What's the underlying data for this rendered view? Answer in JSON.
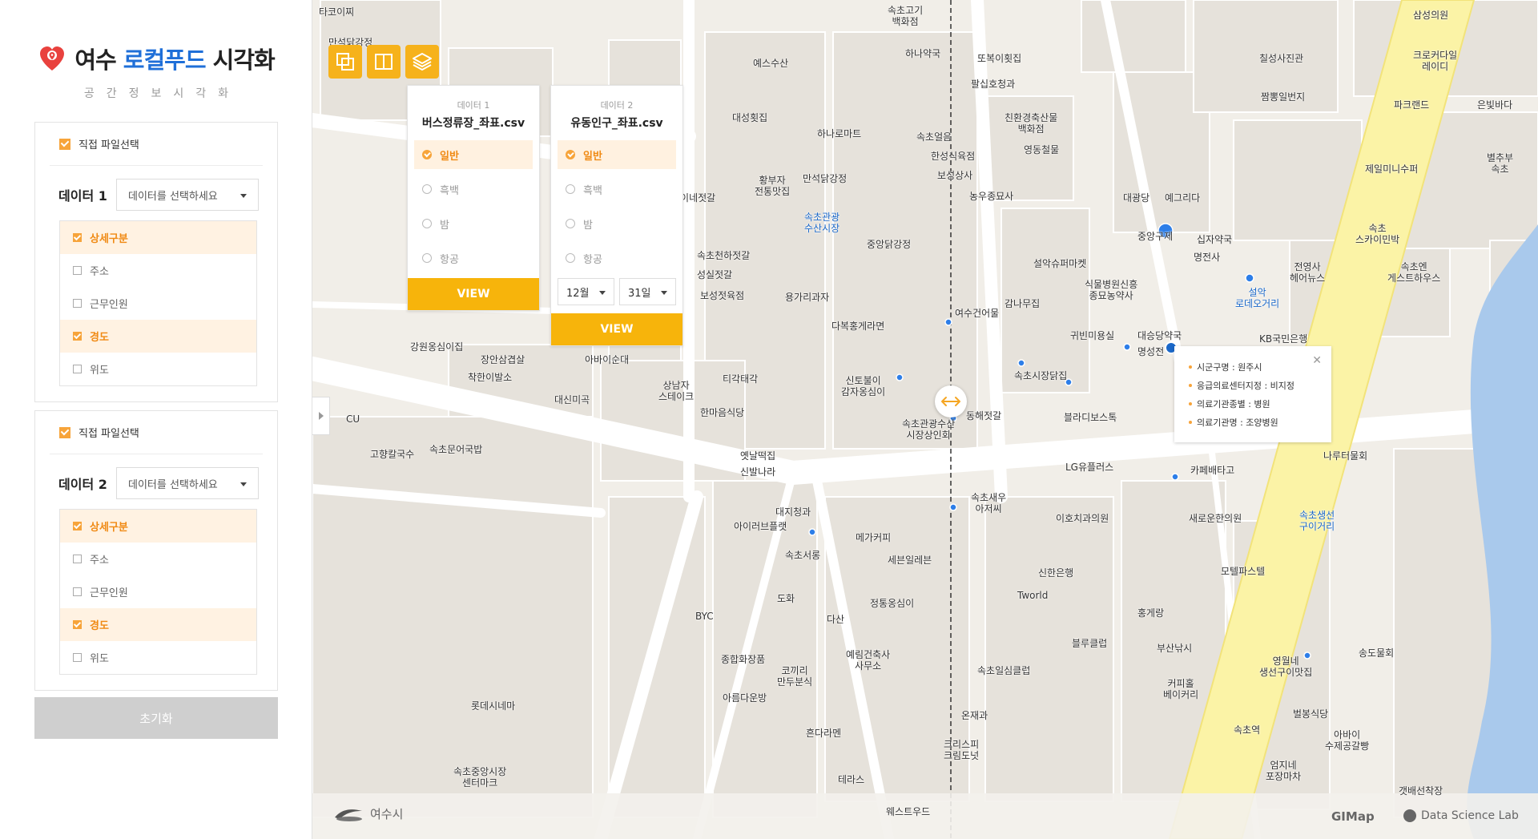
{
  "app": {
    "title_prefix": "여수",
    "title_accent": "로컬푸드",
    "title_suffix": "시각화",
    "subtitle": "공간정보시각화"
  },
  "panels": [
    {
      "file_select_label": "직접 파일선택",
      "data_label": "데이터 1",
      "select_placeholder": "데이터를 선택하세요",
      "fields": [
        {
          "label": "상세구분",
          "checked": true
        },
        {
          "label": "주소",
          "checked": false
        },
        {
          "label": "근무인원",
          "checked": false
        },
        {
          "label": "경도",
          "checked": true
        },
        {
          "label": "위도",
          "checked": false
        }
      ]
    },
    {
      "file_select_label": "직접 파일선택",
      "data_label": "데이터 2",
      "select_placeholder": "데이터를 선택하세요",
      "fields": [
        {
          "label": "상세구분",
          "checked": true
        },
        {
          "label": "주소",
          "checked": false
        },
        {
          "label": "근무인원",
          "checked": false
        },
        {
          "label": "경도",
          "checked": true
        },
        {
          "label": "위도",
          "checked": false
        }
      ]
    }
  ],
  "reset_label": "초기화",
  "cards": [
    {
      "num": "데이터 1",
      "file": "버스정류장_좌표.csv",
      "styles": [
        {
          "label": "일반",
          "on": true
        },
        {
          "label": "흑백",
          "on": false
        },
        {
          "label": "밤",
          "on": false
        },
        {
          "label": "항공",
          "on": false
        }
      ],
      "view_label": "VIEW"
    },
    {
      "num": "데이터 2",
      "file": "유동인구_좌표.csv",
      "styles": [
        {
          "label": "일반",
          "on": true
        },
        {
          "label": "흑백",
          "on": false
        },
        {
          "label": "밤",
          "on": false
        },
        {
          "label": "항공",
          "on": false
        }
      ],
      "month": "12월",
      "day": "31일",
      "view_label": "VIEW"
    }
  ],
  "info_popup": [
    "시군구명 : 원주시",
    "응급의료센터지정 : 비지정",
    "의료기관종별 : 병원",
    "의료기관명 : 조양병원"
  ],
  "map_labels": [
    {
      "t": "타코이찌"
    },
    {
      "t": "만석닭강정"
    },
    {
      "t": "속초고기\n백화점"
    },
    {
      "t": "하나약국"
    },
    {
      "t": "또복이횟집"
    },
    {
      "t": "팔십호청과"
    },
    {
      "t": "삼성의원"
    },
    {
      "t": "칠성사진관"
    },
    {
      "t": "크로커다일\n레이디"
    },
    {
      "t": "짬뽕일번지"
    },
    {
      "t": "파크랜드"
    },
    {
      "t": "은빛바다"
    },
    {
      "t": "예스수산"
    },
    {
      "t": "대성횟집"
    },
    {
      "t": "하나로마트"
    },
    {
      "t": "속초얼음"
    },
    {
      "t": "한성식육점"
    },
    {
      "t": "친환경축산물\n백화점"
    },
    {
      "t": "영동철물"
    },
    {
      "t": "보성상사"
    },
    {
      "t": "농우종묘사"
    },
    {
      "t": "대광당"
    },
    {
      "t": "예그리다"
    },
    {
      "t": "중앙구제"
    },
    {
      "t": "십자약국"
    },
    {
      "t": "명전사"
    },
    {
      "t": "제일미니수퍼"
    },
    {
      "t": "별추부\n속초"
    },
    {
      "t": "속초\n스카이민박"
    },
    {
      "t": "전영사\n헤어뉴스"
    },
    {
      "t": "속초엔\n게스트하우스"
    },
    {
      "t": "황부자\n전통맛집"
    },
    {
      "t": "만석닭강정"
    },
    {
      "t": "속초관광\n수산시장"
    },
    {
      "t": "중앙닭강정"
    },
    {
      "t": "설악슈퍼마켓"
    },
    {
      "t": "식물병원신흥\n종묘농약사"
    },
    {
      "t": "설악\n로데오거리"
    },
    {
      "t": "KB국민은행"
    },
    {
      "t": "용가리과자"
    },
    {
      "t": "다복홍게라면"
    },
    {
      "t": "여수건어물"
    },
    {
      "t": "감나무집"
    },
    {
      "t": "귀빈미용실"
    },
    {
      "t": "대승당약국"
    },
    {
      "t": "명성전"
    },
    {
      "t": "신토불이\n감자옹심이"
    },
    {
      "t": "속초시장닭집"
    },
    {
      "t": "속초관광수산\n시장상인회"
    },
    {
      "t": "동해젓갈"
    },
    {
      "t": "블라디보스톡"
    },
    {
      "t": "나루터물회"
    },
    {
      "t": "LG유플러스"
    },
    {
      "t": "카페배타고"
    },
    {
      "t": "속초새우\n아저씨"
    },
    {
      "t": "이호치과의원"
    },
    {
      "t": "새로운한의원"
    },
    {
      "t": "속초생선\n구이거리"
    },
    {
      "t": "모텔파스텔"
    },
    {
      "t": "신한은행"
    },
    {
      "t": "Tworld"
    },
    {
      "t": "홍게랑"
    },
    {
      "t": "블루클럽"
    },
    {
      "t": "부산낚시"
    },
    {
      "t": "영월네\n생선구이맛집"
    },
    {
      "t": "송도물회"
    },
    {
      "t": "커피홀\n베이커리"
    },
    {
      "t": "벌봉식당"
    },
    {
      "t": "아바이\n수제공갈빵"
    },
    {
      "t": "속초역"
    },
    {
      "t": "엄지네\n포장마차"
    },
    {
      "t": "갯배선착장"
    },
    {
      "t": "속초일심클럽"
    },
    {
      "t": "온재과"
    },
    {
      "t": "크리스피\n크림도넛"
    },
    {
      "t": "웨스트우드"
    },
    {
      "t": "테라스"
    },
    {
      "t": "흔다라멘"
    },
    {
      "t": "예림건축사\n사무소"
    },
    {
      "t": "정통옹심이"
    },
    {
      "t": "다산"
    },
    {
      "t": "세븐일레븐"
    },
    {
      "t": "메가커피"
    },
    {
      "t": "대지청과"
    },
    {
      "t": "아이러브플랫"
    },
    {
      "t": "속초서롱"
    },
    {
      "t": "도화"
    },
    {
      "t": "BYC"
    },
    {
      "t": "종합화장품"
    },
    {
      "t": "코끼리\n만두분식"
    },
    {
      "t": "아름다운방"
    },
    {
      "t": "롯데시네마"
    },
    {
      "t": "속초중앙시장\n센터마크"
    },
    {
      "t": "고향칼국수"
    },
    {
      "t": "속초문어국밥"
    },
    {
      "t": "CU"
    },
    {
      "t": "강원옹심이집"
    },
    {
      "t": "장안삼겹살"
    },
    {
      "t": "착한이발소"
    },
    {
      "t": "대신미곡"
    },
    {
      "t": "상남자\n스테이크"
    },
    {
      "t": "티각태각"
    },
    {
      "t": "한마음식당"
    },
    {
      "t": "옛날떡집"
    },
    {
      "t": "신발나라"
    },
    {
      "t": "아바이순대"
    },
    {
      "t": "속초천하젓갈"
    },
    {
      "t": "성실젓갈"
    },
    {
      "t": "보성젓육점"
    },
    {
      "t": "초이네젓갈"
    }
  ],
  "footer": {
    "city_logo": "여수시",
    "gimap": "GIMap",
    "dsl": "Data Science Lab"
  },
  "colors": {
    "accent_orange": "#f7a43a",
    "button_yellow": "#f7b40b",
    "brand_blue": "#1f6fd8",
    "map_bg": "#f1eee8",
    "road_yellow": "#fbf3a6",
    "water": "#a9c9ec"
  }
}
